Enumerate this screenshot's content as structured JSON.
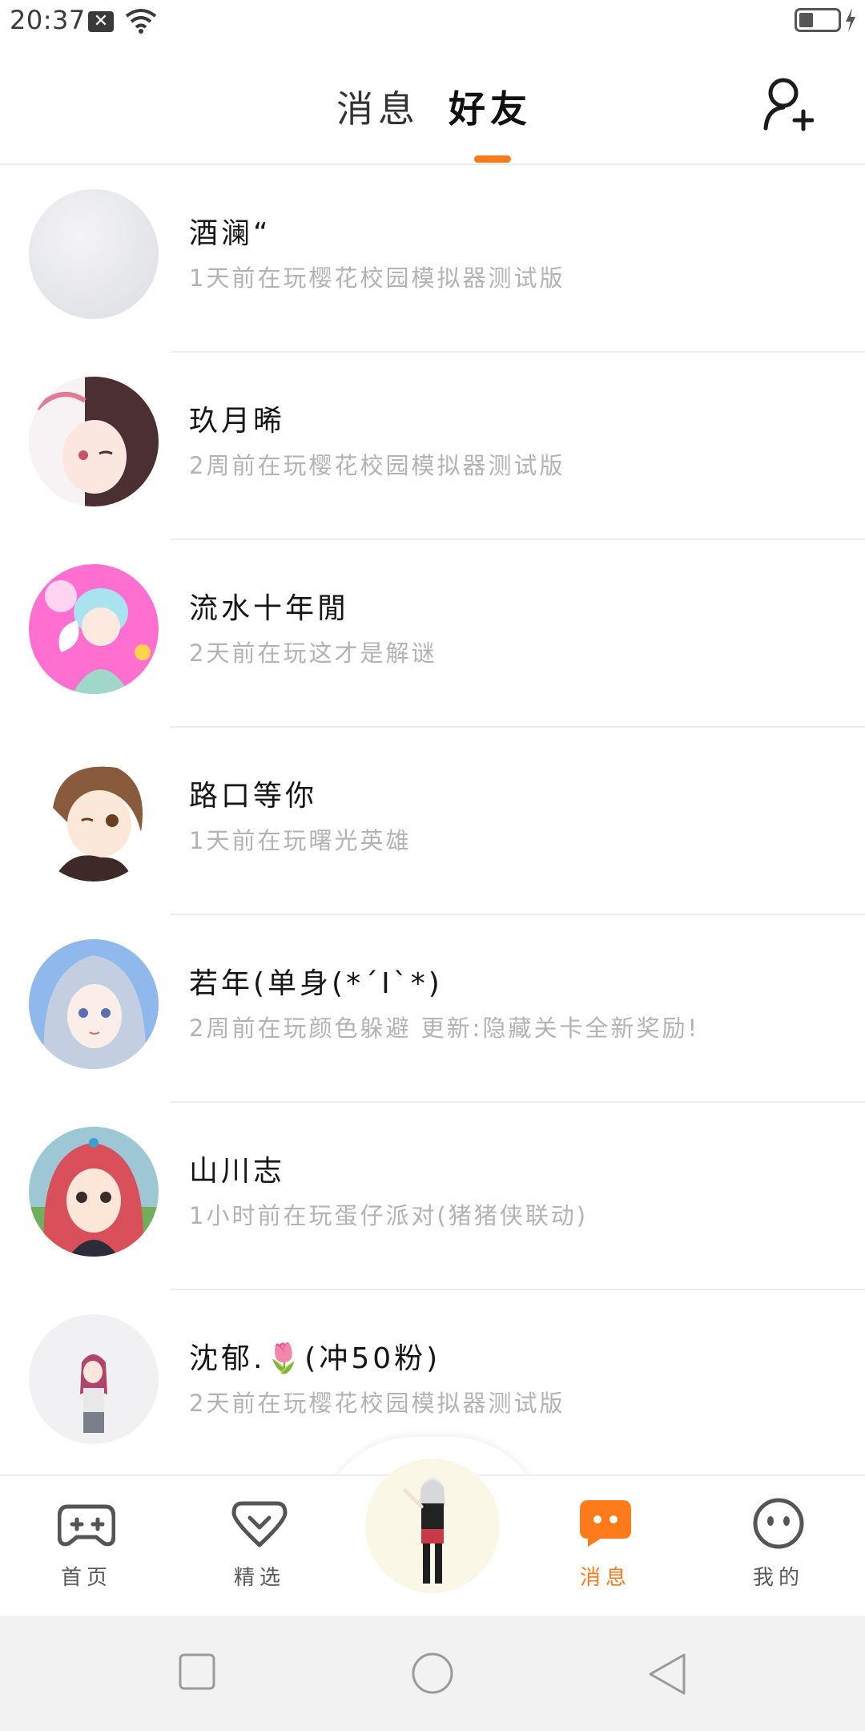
{
  "status_bar": {
    "time": "20:37",
    "notification_icon": "x-box-icon",
    "battery_percent": 30
  },
  "header": {
    "tab_messages": "消息",
    "tab_friends": "好友",
    "active_tab": "好友",
    "add_friend_icon": "add-user-icon"
  },
  "friends": [
    {
      "name": "酒澜“",
      "status": "1天前在玩樱花校园模拟器测试版"
    },
    {
      "name": "玖月晞",
      "status": "2周前在玩樱花校园模拟器测试版"
    },
    {
      "name": "流水十年閒",
      "status": "2天前在玩这才是解谜"
    },
    {
      "name": "路口等你",
      "status": "1天前在玩曙光英雄"
    },
    {
      "name": "若年(单身(*´I`*)",
      "status": "2周前在玩颜色躲避 更新:隐藏关卡全新奖励!"
    },
    {
      "name": "山川志",
      "status": "1小时前在玩蛋仔派对(猪猪侠联动)"
    },
    {
      "name": "沈郁.🌷(冲50粉)",
      "status": "2天前在玩樱花校园模拟器测试版"
    }
  ],
  "bottom_nav": {
    "home": "首页",
    "featured": "精选",
    "messages": "消息",
    "me": "我的",
    "active": "消息"
  },
  "colors": {
    "accent": "#ff7a1a",
    "divider": "#ececec",
    "muted_text": "#b3b3b3"
  }
}
